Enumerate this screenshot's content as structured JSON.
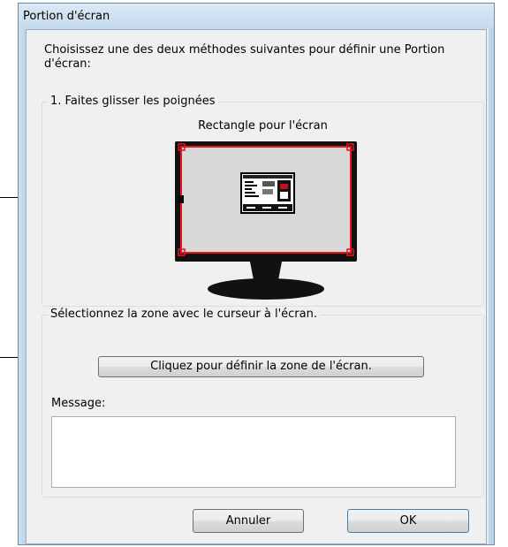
{
  "window": {
    "title": "Portion d'écran"
  },
  "instructions": "Choisissez une des deux méthodes suivantes pour définir une Portion d'écran:",
  "handles_group": {
    "legend": "1. Faites glisser les poignées",
    "rect_label": "Rectangle pour l'écran"
  },
  "cursor_group": {
    "legend": "Sélectionnez la zone avec le curseur à l'écran.",
    "define_button": "Cliquez pour définir la zone de l'écran.",
    "message_label": "Message:",
    "message_value": ""
  },
  "buttons": {
    "cancel": "Annuler",
    "ok": "OK"
  },
  "colors": {
    "selection": "#e8141c",
    "window_frame": "#bcd3ea",
    "monitor": "#111111"
  },
  "icons": [
    "monitor-preview-icon",
    "corner-handle-icon",
    "side-handle-icon",
    "screen-thumbnail-icon"
  ]
}
